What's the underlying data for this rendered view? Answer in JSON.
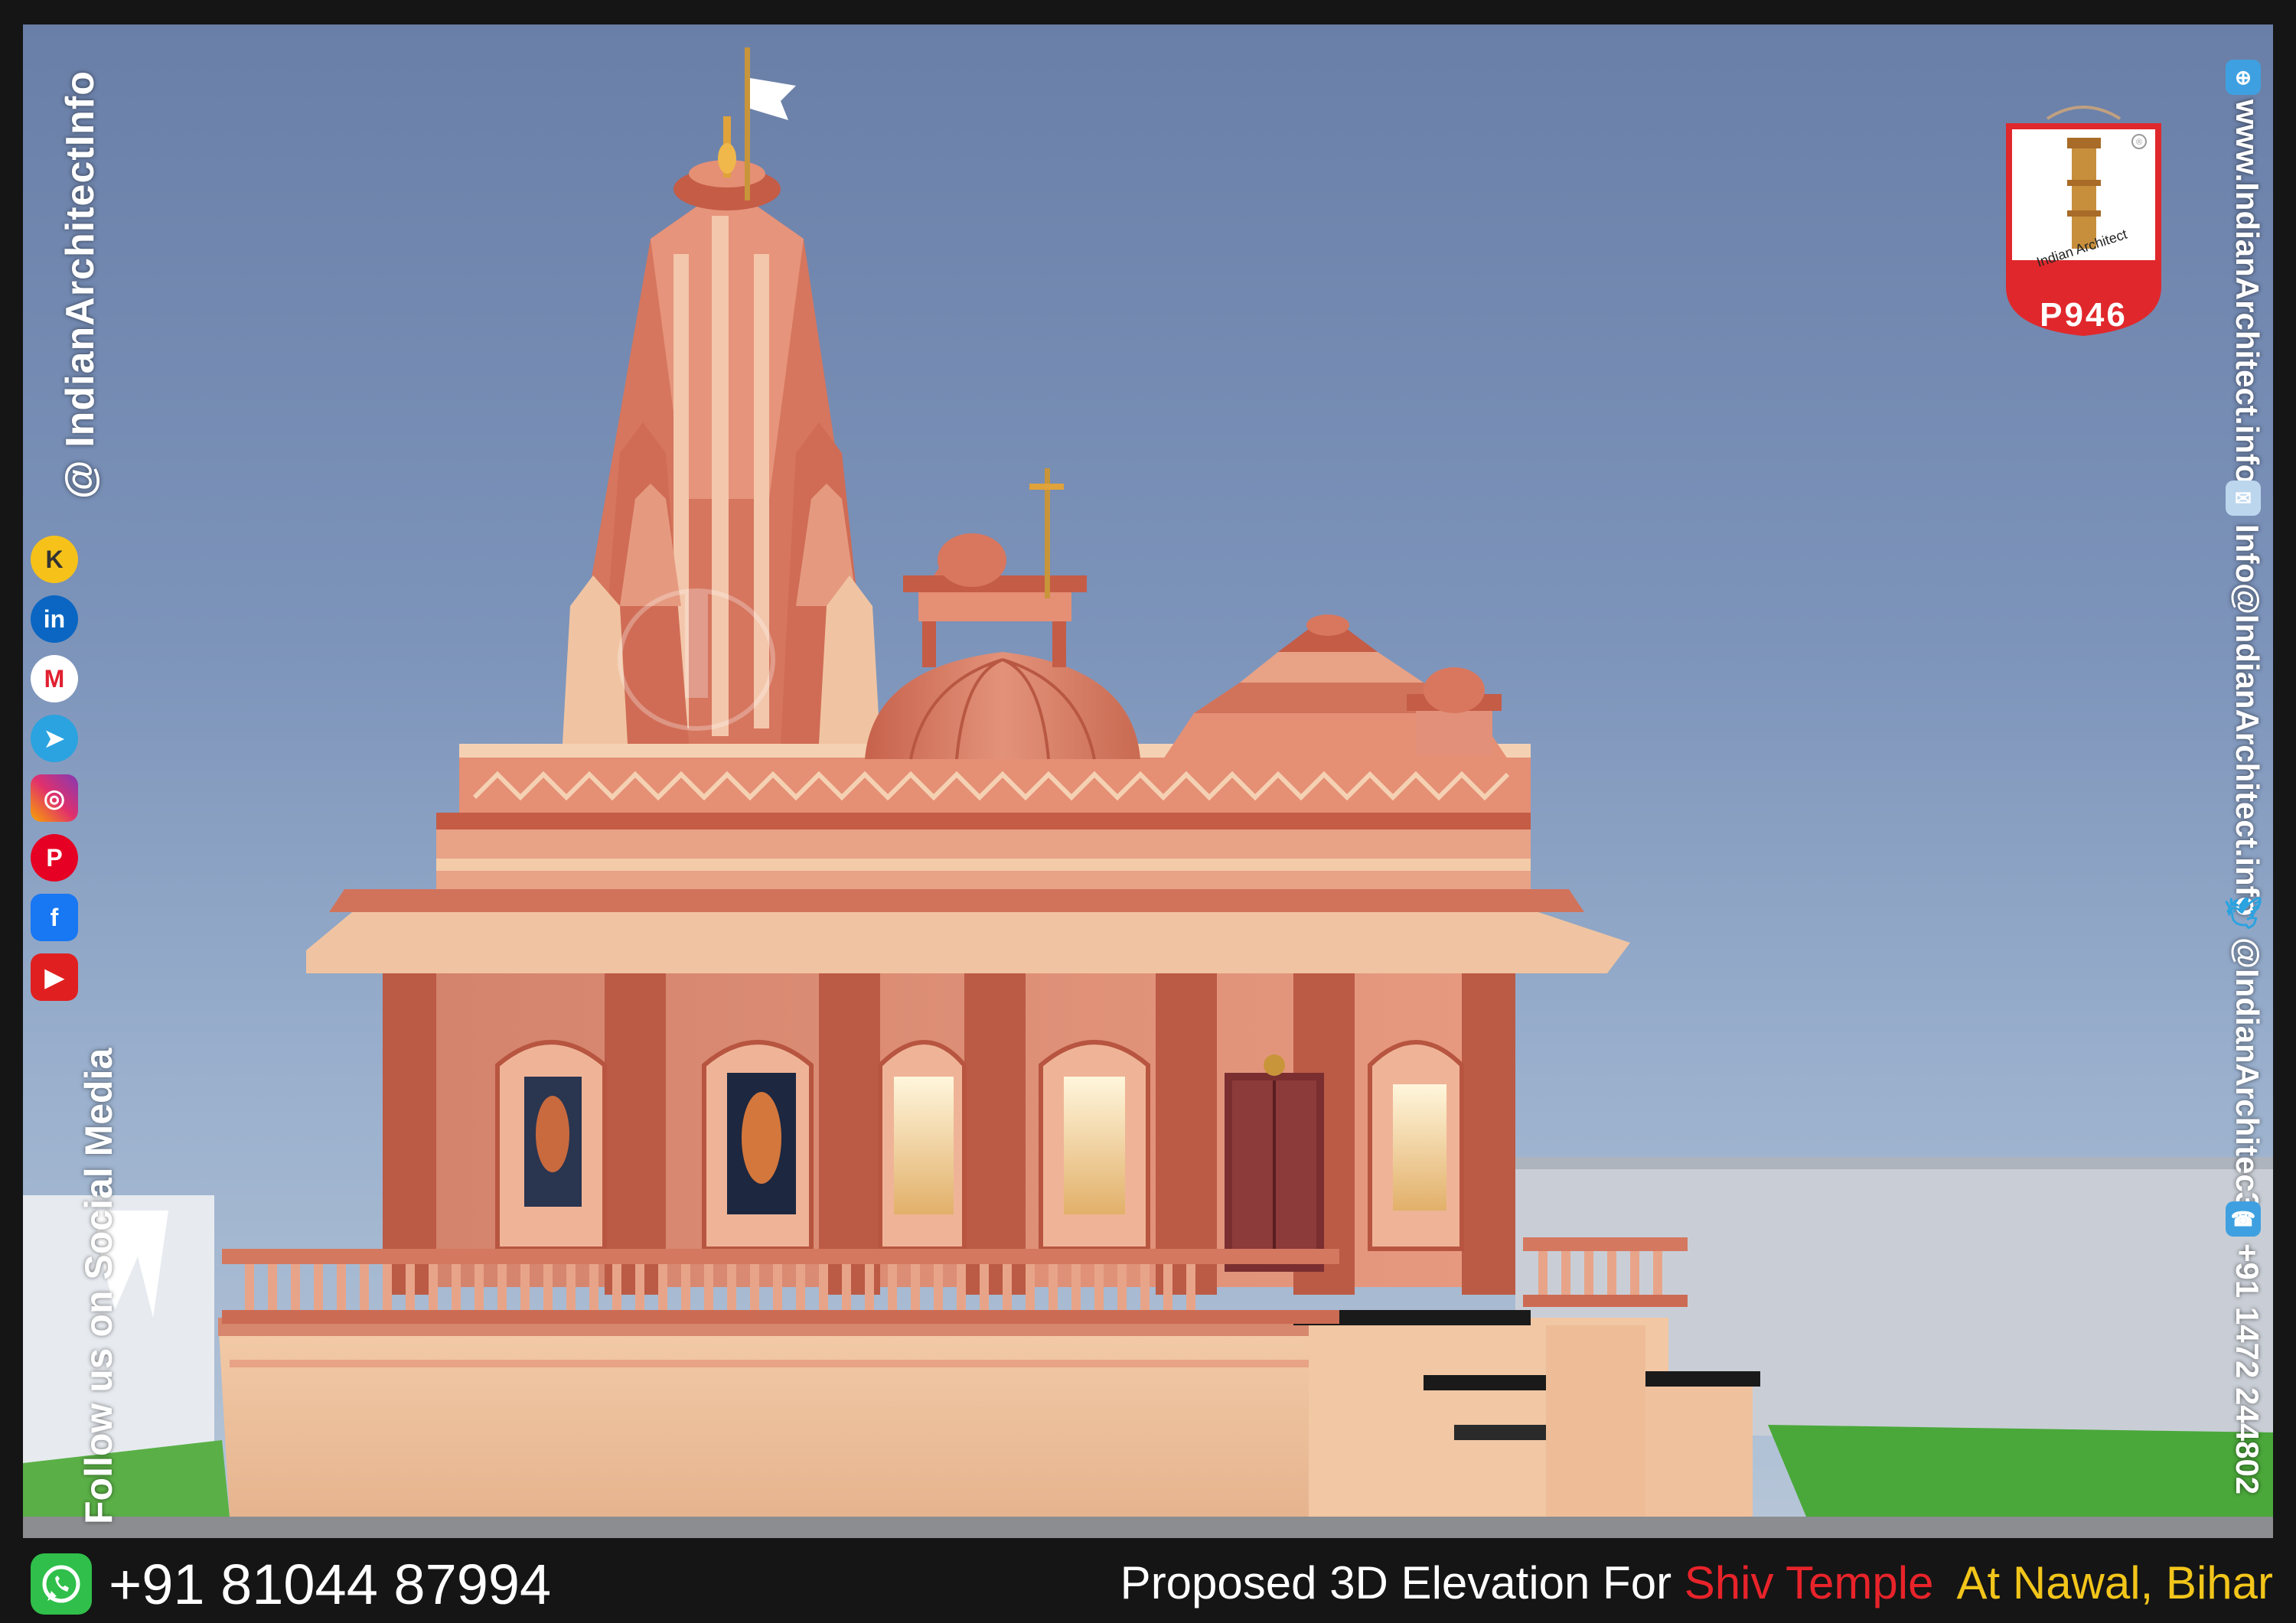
{
  "social": {
    "handle": "@ IndianArchitectInfo",
    "follow_text": "Follow us on Social Media",
    "icons": [
      "youtube-icon",
      "facebook-icon",
      "pinterest-icon",
      "instagram-icon",
      "telegram-icon",
      "moj-icon",
      "linkedin-icon",
      "koo-icon"
    ]
  },
  "contact": {
    "website": "www.IndianArchitect.info",
    "email": "Info@IndianArchitect.info",
    "twitter": "@IndianArchitec3",
    "phone": "+91 1472 244802"
  },
  "logo": {
    "brand": "Indian Architect",
    "code": "P946",
    "mark": "®"
  },
  "footer": {
    "whatsapp": "+91 81044 87994",
    "caption_part1": "Proposed 3D Elevation For ",
    "caption_part2": "Shiv Temple",
    "caption_part3": "  At Nawal, Bihar"
  },
  "watermark": "Indian Architect",
  "colors": {
    "sky": "#7c93ba",
    "temple_red": "#c8634d",
    "temple_cream": "#f0c4a2",
    "caption_red": "#e8232a",
    "caption_yellow": "#f2c51a",
    "logo_red": "#e0282c"
  }
}
